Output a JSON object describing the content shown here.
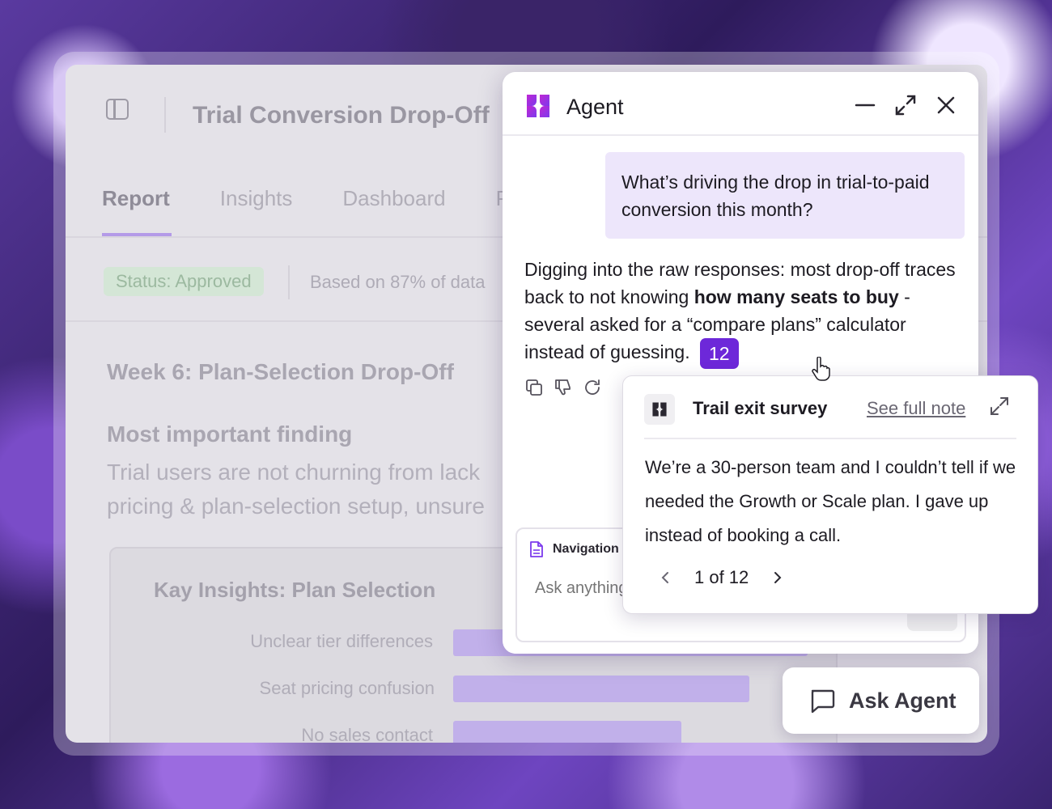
{
  "report": {
    "title": "Trial Conversion Drop-Off",
    "tabs": [
      {
        "label": "Report"
      },
      {
        "label": "Insights"
      },
      {
        "label": "Dashboard"
      },
      {
        "label": "P"
      }
    ],
    "status": "Status: Approved",
    "data_note": "Based on 87% of data",
    "week_heading": "Week 6: Plan-Selection Drop-Off",
    "finding_heading": "Most important finding",
    "finding_line1": "Trial users are not churning from lack",
    "finding_line2": "pricing & plan-selection setup, unsure",
    "insights": {
      "title": "Kay Insights: Plan Selection",
      "labels": [
        "Unclear tier differences",
        "Seat pricing confusion",
        "No sales contact"
      ],
      "values": [
        0.73,
        0.61,
        0.47
      ]
    }
  },
  "agent": {
    "title": "Agent",
    "user_message": "What’s driving the drop in trial-to-paid conversion this month?",
    "reply_part1": "Digging into the raw responses: most drop-off traces back to not knowing ",
    "reply_bold": "how many seats to buy",
    "reply_part2": " - several asked for a “compare plans” calculator instead of guessing.",
    "citation": "12",
    "composer": {
      "context_chip": "Navigation I",
      "placeholder": "Ask anything"
    }
  },
  "source": {
    "title": "Trail exit survey",
    "link": "See full note",
    "quote": "We’re a 30-person team and I couldn’t tell if we needed the Growth or Scale plan. I gave up instead of booking a call.",
    "pager": "1 of 12"
  },
  "ask_agent": {
    "label": "Ask Agent"
  },
  "colors": {
    "accent": "#6d28d9",
    "user_bubble": "#ede6fb",
    "status_bg": "#d4e6d6"
  }
}
